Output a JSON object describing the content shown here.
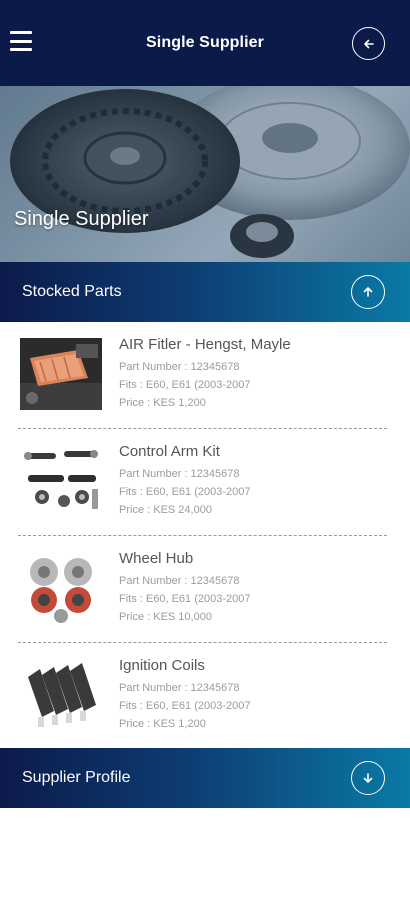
{
  "header": {
    "title": "Single Supplier"
  },
  "hero": {
    "title": "Single Supplier"
  },
  "stocked_section": {
    "label": "Stocked Parts"
  },
  "profile_section": {
    "label": "Supplier Profile"
  },
  "parts": [
    {
      "name": "AIR Fitler - Hengst, Mayle",
      "part_number": "Part Number : 12345678",
      "fits": "Fits : E60, E61 (2003-2007",
      "price": "Price : KES 1,200"
    },
    {
      "name": "Control Arm Kit",
      "part_number": "Part Number : 12345678",
      "fits": "Fits : E60, E61 (2003-2007",
      "price": "Price : KES 24,000"
    },
    {
      "name": "Wheel Hub",
      "part_number": "Part Number : 12345678",
      "fits": "Fits : E60, E61 (2003-2007",
      "price": "Price : KES 10,000"
    },
    {
      "name": "Ignition Coils",
      "part_number": "Part Number : 12345678",
      "fits": "Fits : E60, E61 (2003-2007",
      "price": "Price : KES 1,200"
    }
  ],
  "icons": {
    "menu": "menu-icon",
    "back": "arrow-left-icon",
    "collapse": "arrow-up-icon",
    "expand": "arrow-down-icon"
  },
  "colors": {
    "header": "#0c1a4a",
    "accent": "#0a7aa6"
  }
}
